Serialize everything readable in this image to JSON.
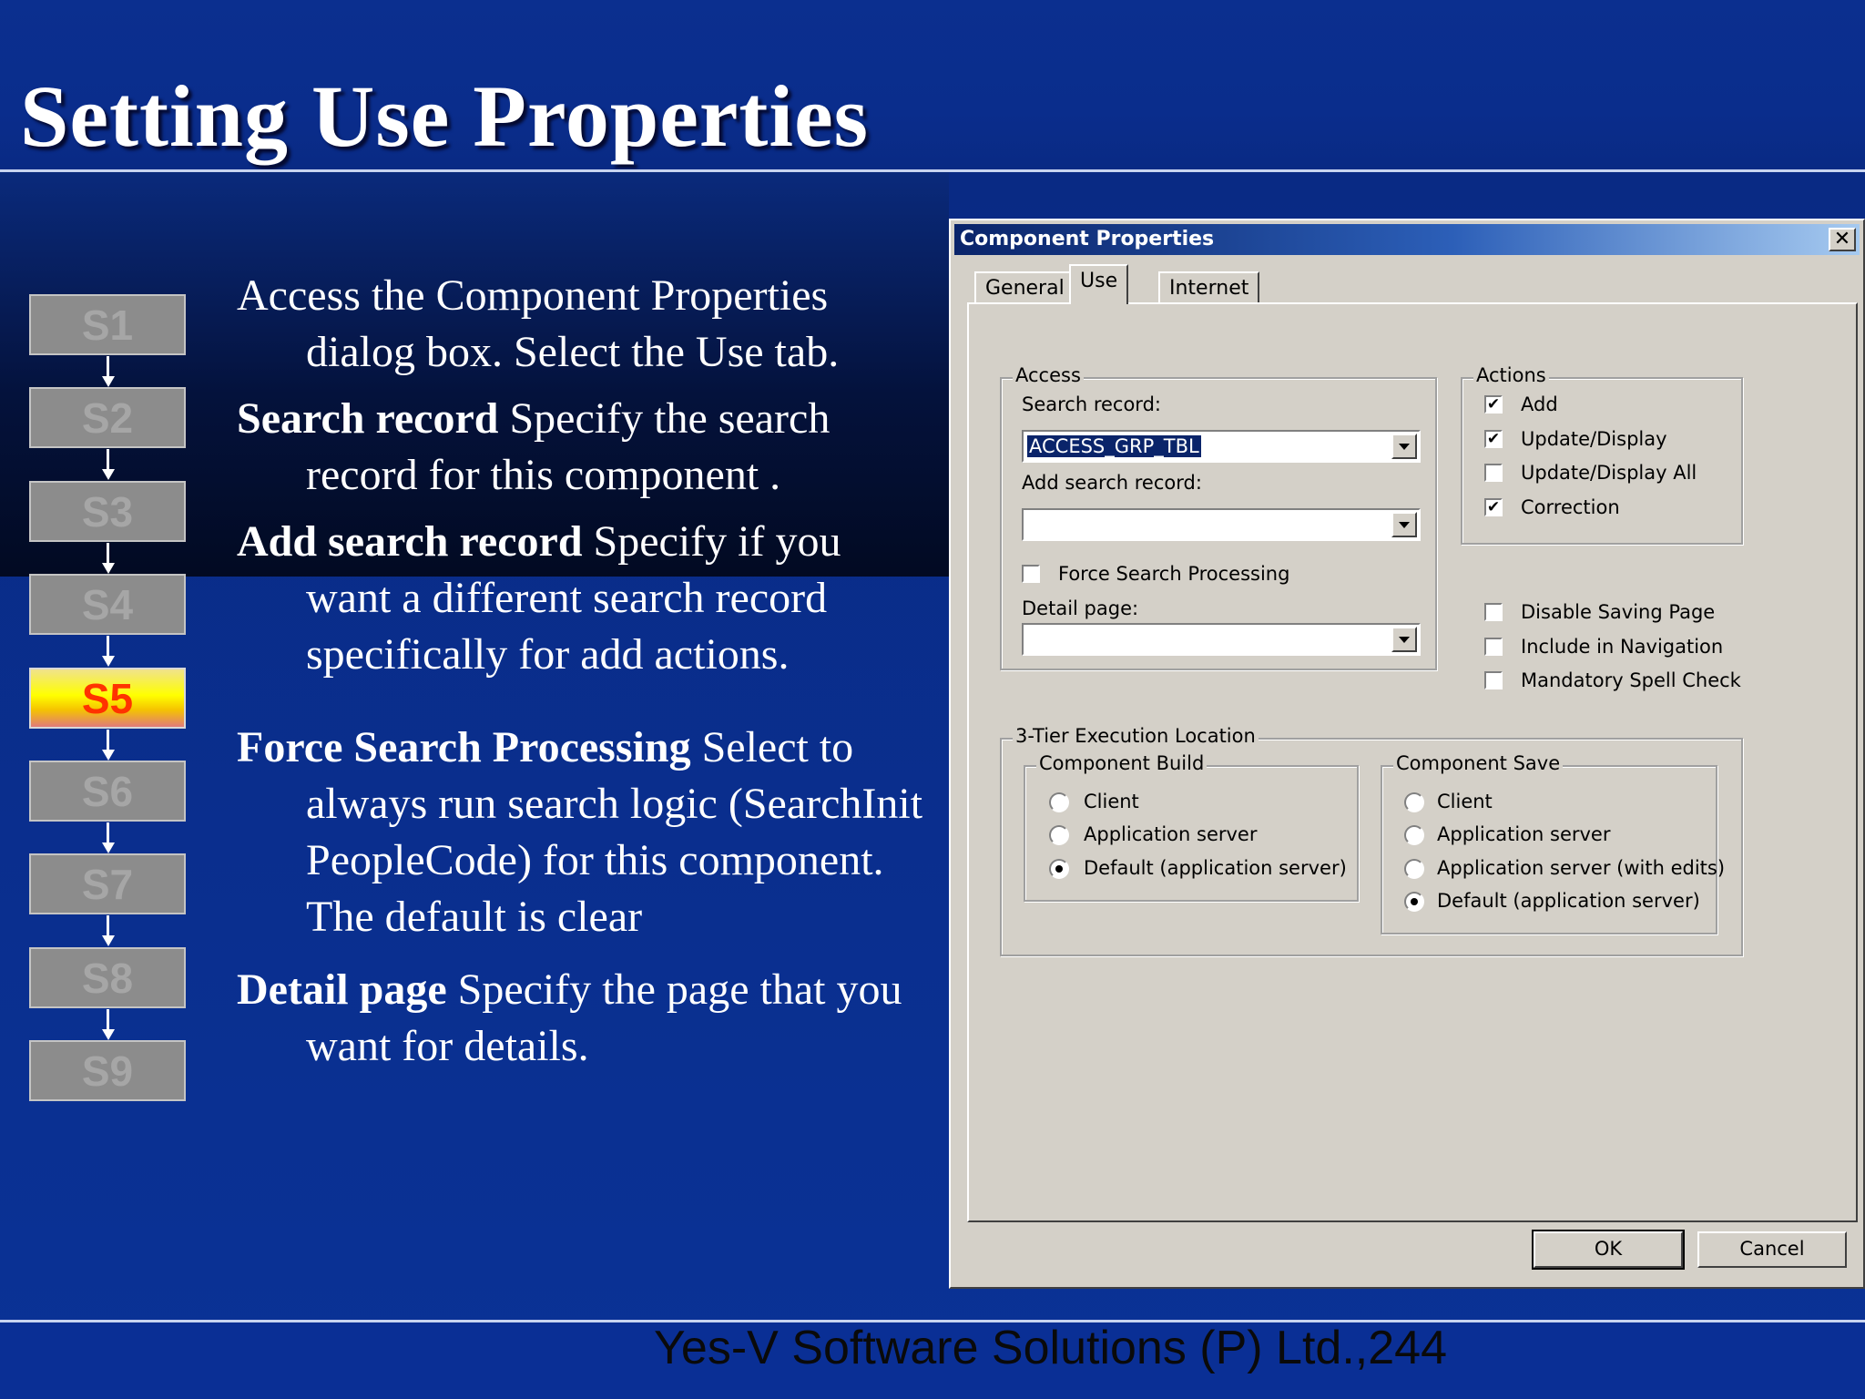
{
  "slide": {
    "title": "Setting Use Properties",
    "footer": "Yes-V Software Solutions (P) Ltd.,244"
  },
  "steps": [
    {
      "label": "S1",
      "active": false
    },
    {
      "label": "S2",
      "active": false
    },
    {
      "label": "S3",
      "active": false
    },
    {
      "label": "S4",
      "active": false
    },
    {
      "label": "S5",
      "active": true
    },
    {
      "label": "S6",
      "active": false
    },
    {
      "label": "S7",
      "active": false
    },
    {
      "label": "S8",
      "active": false
    },
    {
      "label": "S9",
      "active": false
    }
  ],
  "paragraphs": {
    "intro": {
      "line1": "Access the Component Properties",
      "line2": "dialog box. Select the Use tab."
    },
    "search_record": {
      "label": "Search record",
      "line1": " Specify the search",
      "line2": "record for this component ."
    },
    "add_search_record": {
      "label": "Add search record",
      "line1": " Specify if you",
      "line2": "want a different search record",
      "line3": "specifically for add actions."
    },
    "force_search": {
      "label": "Force Search Processing",
      "line1": "  Select to",
      "line2": "always run search logic (SearchInit",
      "line3": "PeopleCode) for this component.",
      "line4": "The default is clear"
    },
    "detail_page": {
      "label": "Detail page",
      "line1": " Specify the page that you",
      "line2": "want for details."
    }
  },
  "dialog": {
    "title": "Component Properties",
    "close_label": "✕",
    "tabs": [
      {
        "label": "General",
        "selected": false
      },
      {
        "label": "Use",
        "selected": true
      },
      {
        "label": "Internet",
        "selected": false
      }
    ],
    "access": {
      "legend": "Access",
      "search_record_label": "Search record:",
      "search_record_value": "ACCESS_GRP_TBL",
      "add_search_record_label": "Add search record:",
      "add_search_record_value": "",
      "force_search_label": "Force Search Processing",
      "force_search_checked": false,
      "detail_page_label": "Detail page:",
      "detail_page_value": ""
    },
    "actions": {
      "legend": "Actions",
      "items": [
        {
          "label": "Add",
          "checked": true
        },
        {
          "label": "Update/Display",
          "checked": true
        },
        {
          "label": "Update/Display All",
          "checked": false
        },
        {
          "label": "Correction",
          "checked": true
        }
      ]
    },
    "options": [
      {
        "label": "Disable Saving Page",
        "checked": false
      },
      {
        "label": "Include in Navigation",
        "checked": false
      },
      {
        "label": "Mandatory Spell Check",
        "checked": false
      }
    ],
    "execution": {
      "legend": "3-Tier Execution Location",
      "build": {
        "legend": "Component Build",
        "options": [
          {
            "label": "Client",
            "selected": false
          },
          {
            "label": "Application server",
            "selected": false
          },
          {
            "label": "Default (application server)",
            "selected": true
          }
        ]
      },
      "save": {
        "legend": "Component Save",
        "options": [
          {
            "label": "Client",
            "selected": false
          },
          {
            "label": "Application server",
            "selected": false
          },
          {
            "label": "Application server (with edits)",
            "selected": false
          },
          {
            "label": "Default (application server)",
            "selected": true
          }
        ]
      }
    },
    "buttons": {
      "ok": "OK",
      "cancel": "Cancel"
    }
  }
}
